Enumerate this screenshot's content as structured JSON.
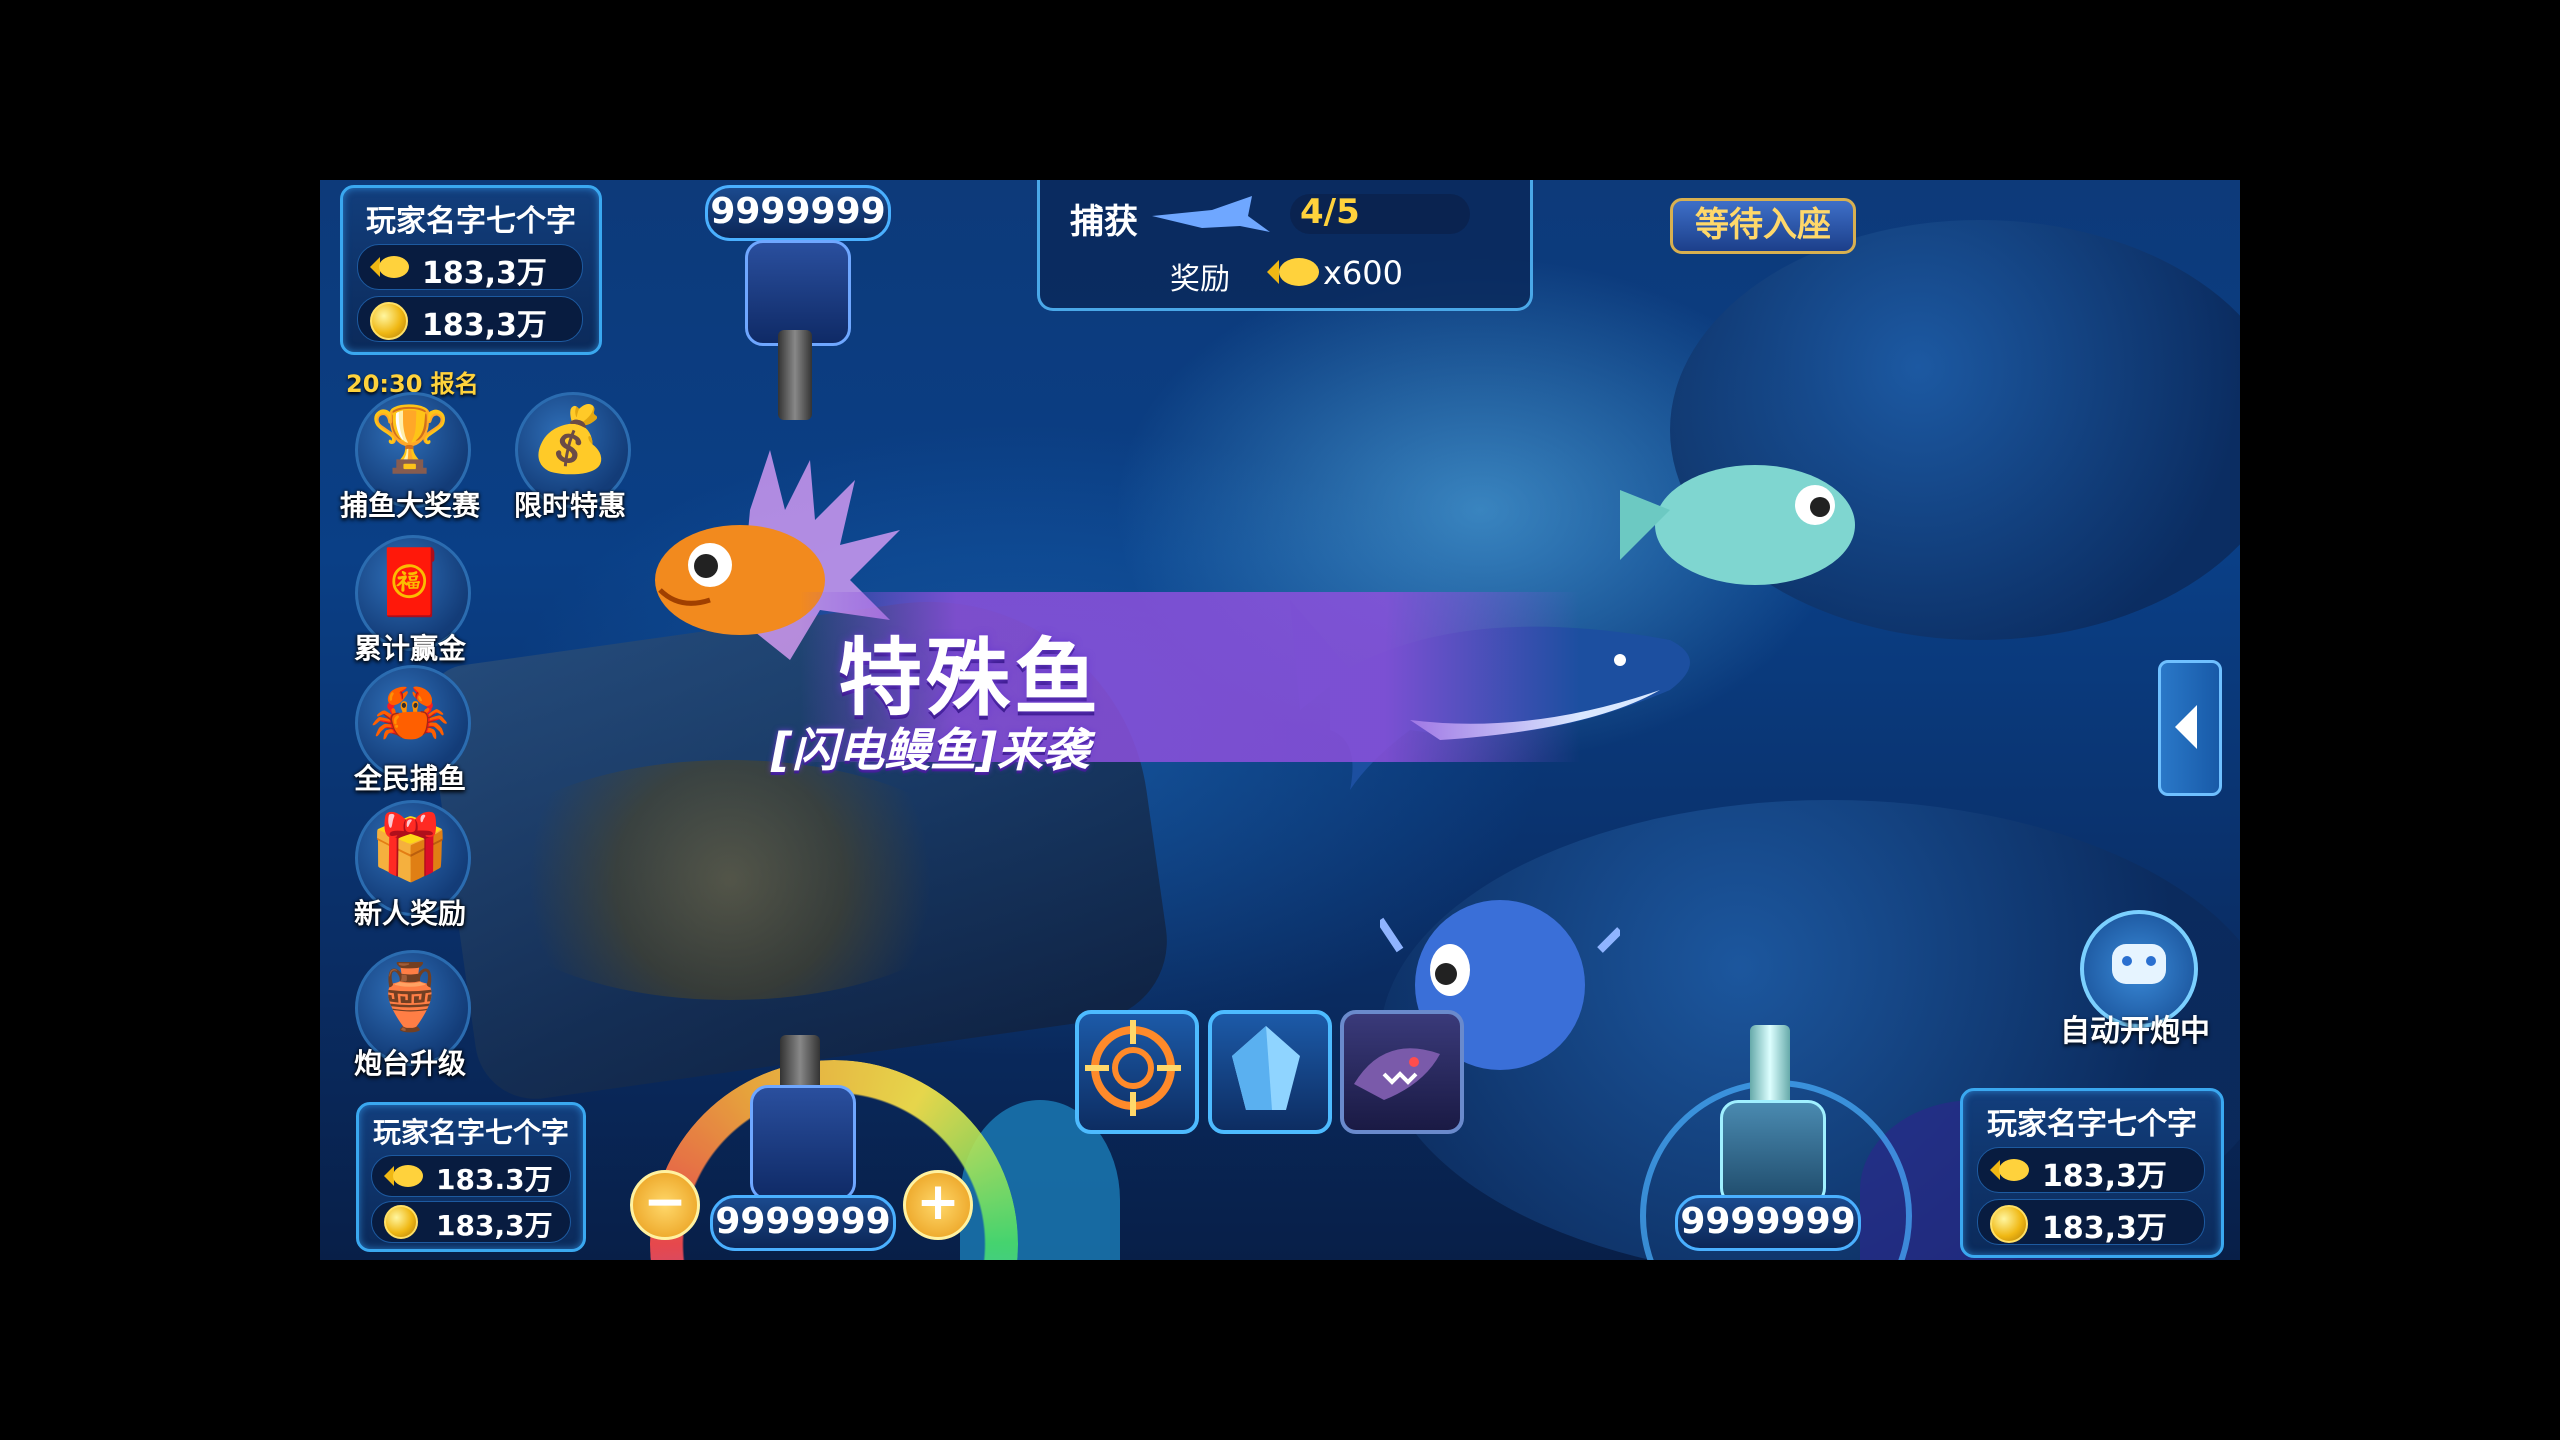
{
  "players": {
    "top_left": {
      "name": "玩家名字七个字",
      "fish_value": "183,3万",
      "coin_value": "183,3万"
    },
    "bottom_left": {
      "name": "玩家名字七个字",
      "fish_value": "183.3万",
      "coin_value": "183,3万"
    },
    "bottom_right": {
      "name": "玩家名字七个字",
      "fish_value": "183,3万",
      "coin_value": "183,3万"
    }
  },
  "cannons": {
    "top_left_ammo": "9999999",
    "bottom_left_ammo": "9999999",
    "bottom_right_ammo": "9999999",
    "minus_label": "−",
    "plus_label": "+"
  },
  "task": {
    "capture_label": "捕获",
    "progress": "4/5",
    "reward_label": "奖励",
    "reward_value": "x600"
  },
  "seat": {
    "waiting_label": "等待入座"
  },
  "menu": {
    "tournament_time": "20:30 报名",
    "items": [
      {
        "label": "捕鱼大奖赛",
        "icon": "trophy-icon"
      },
      {
        "label": "限时特惠",
        "icon": "treasure-chest-icon"
      },
      {
        "label": "累计赢金",
        "icon": "red-envelope-icon"
      },
      {
        "label": "全民捕鱼",
        "icon": "mascot-icon"
      },
      {
        "label": "新人奖励",
        "icon": "gift-icon"
      },
      {
        "label": "炮台升级",
        "icon": "gourd-icon"
      }
    ]
  },
  "banner": {
    "title": "特殊鱼",
    "subtitle": "[闪电鳗鱼]来袭"
  },
  "auto_fire": {
    "label": "自动开炮中",
    "icon": "robot-icon"
  },
  "skills": [
    {
      "icon": "target-icon"
    },
    {
      "icon": "crystal-icon"
    },
    {
      "icon": "shark-icon"
    }
  ],
  "side_toggle": {
    "icon": "chevron-left-icon"
  },
  "colors": {
    "accent": "#3aa8f0",
    "banner": "#8c50dc",
    "progress": "#ffd23c",
    "gold": "#f0b814"
  }
}
